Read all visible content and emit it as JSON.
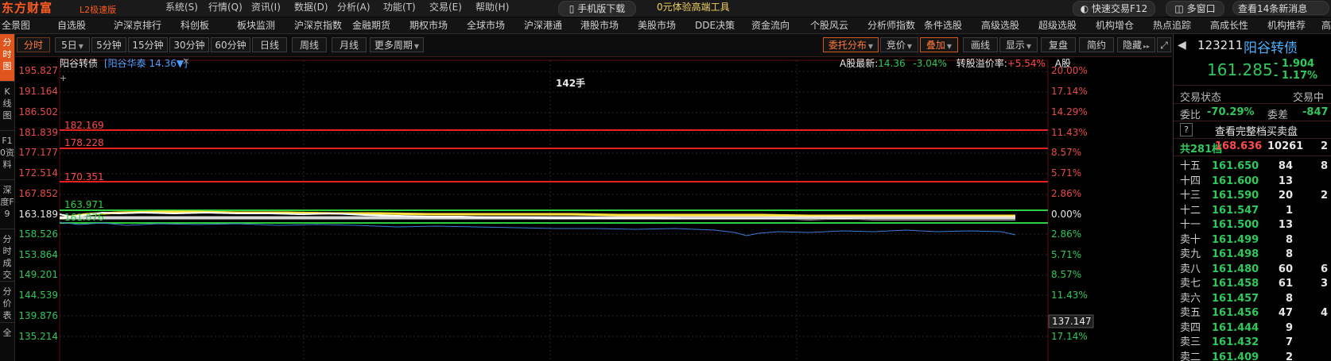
{
  "app": {
    "logo": "东方财富",
    "edition": "L2极速版"
  },
  "menu": [
    "系统(S)",
    "行情(Q)",
    "资讯(I)",
    "数据(D)",
    "分析(A)",
    "功能(T)",
    "交易(E)",
    "帮助(H)"
  ],
  "top_right": {
    "mobile_download": "手机版下载",
    "promo": "0元体验高端工具",
    "quick_trade": "快速交易F12",
    "multi_window": "多窗口",
    "news": "查看14条新消息"
  },
  "nav": [
    "全景图",
    "自选股",
    "沪深京排行",
    "科创板",
    "板块监测",
    "沪深京指数",
    "金融期货",
    "期权市场",
    "全球市场",
    "沪深港通",
    "港股市场",
    "美股市场",
    "DDE决策",
    "资金流向",
    "个股风云",
    "分析师指数",
    "条件选股",
    "高级选股",
    "超级选股",
    "机构增仓",
    "热点追踪",
    "高成长性",
    "机构推荐",
    "高"
  ],
  "left_rail": [
    {
      "label": "分时图",
      "active": true
    },
    {
      "label": "K线图",
      "active": false
    },
    {
      "label": "F10资料",
      "active": false
    },
    {
      "label": "深度F9",
      "active": false
    },
    {
      "label": "分时成交",
      "active": false
    },
    {
      "label": "分价表",
      "active": false
    },
    {
      "label": "全",
      "active": false
    }
  ],
  "toolbar": {
    "left": [
      "分时",
      "5日",
      "5分钟",
      "15分钟",
      "30分钟",
      "60分钟",
      "日线",
      "周线",
      "月线",
      "更多周期"
    ],
    "right": [
      "委托分布",
      "竞价",
      "叠加",
      "画线",
      "显示",
      "复盘",
      "简约",
      "隐藏"
    ]
  },
  "chart": {
    "stock_name": "阳谷转债",
    "overlay_tag": "[阳谷华泰 14.36▼]",
    "header_info": {
      "a_share_latest_label": "A股最新:",
      "a_share_latest_value": "14.36",
      "a_share_change": "-3.04%",
      "premium_label": "转股溢价率:",
      "premium_value": "+5.54%",
      "a_share_tag": "A股"
    },
    "volume_label": "142手",
    "price_ticks": [
      "195.827",
      "191.164",
      "186.502",
      "181.839",
      "177.177",
      "172.514",
      "167.852",
      "163.189",
      "158.526",
      "153.864",
      "149.201",
      "144.539",
      "139.876",
      "135.214"
    ],
    "pct_ticks": [
      "20.00%",
      "17.14%",
      "14.29%",
      "11.43%",
      "8.57%",
      "5.71%",
      "2.86%",
      "0.00%",
      "2.86%",
      "5.71%",
      "8.57%",
      "11.43%",
      "14.29%",
      "17.14%"
    ],
    "ref_lines": [
      {
        "label": "182.169",
        "color": "#e82020"
      },
      {
        "label": "178.228",
        "color": "#e82020"
      },
      {
        "label": "170.351",
        "color": "#e82020"
      },
      {
        "label": "163.971",
        "color": "#2fd040"
      },
      {
        "label": "161.076",
        "color": "#2fd040"
      }
    ],
    "cursor_value": "137.147"
  },
  "right_panel": {
    "code": "123211",
    "name": "阳谷转债",
    "price": "161.285",
    "change": "- 1.904",
    "change_pct": "- 1.17%",
    "status_label": "交易状态",
    "status_label2": "交易中",
    "ratio_label": "委比",
    "ratio_value": "-70.29%",
    "diff_label": "委差",
    "diff_value": "-847",
    "help_icon": "?",
    "full_book": "查看完整档买卖盘",
    "total_label": "共281档",
    "total_price": "168.636",
    "total_vol": "10261",
    "total_extra": "2",
    "book": [
      {
        "label": "十五",
        "price": "161.650",
        "vol": "84",
        "extra": "8"
      },
      {
        "label": "十四",
        "price": "161.600",
        "vol": "13",
        "extra": ""
      },
      {
        "label": "十三",
        "price": "161.590",
        "vol": "20",
        "extra": "2"
      },
      {
        "label": "十二",
        "price": "161.547",
        "vol": "1",
        "extra": ""
      },
      {
        "label": "十一",
        "price": "161.500",
        "vol": "13",
        "extra": ""
      },
      {
        "label": "卖十",
        "price": "161.499",
        "vol": "8",
        "extra": ""
      },
      {
        "label": "卖九",
        "price": "161.498",
        "vol": "8",
        "extra": ""
      },
      {
        "label": "卖八",
        "price": "161.480",
        "vol": "60",
        "extra": "6"
      },
      {
        "label": "卖七",
        "price": "161.458",
        "vol": "61",
        "extra": "3"
      },
      {
        "label": "卖六",
        "price": "161.457",
        "vol": "8",
        "extra": ""
      },
      {
        "label": "卖五",
        "price": "161.456",
        "vol": "47",
        "extra": "4"
      },
      {
        "label": "卖四",
        "price": "161.444",
        "vol": "9",
        "extra": ""
      },
      {
        "label": "卖三",
        "price": "161.432",
        "vol": "7",
        "extra": ""
      },
      {
        "label": "卖二",
        "price": "161.409",
        "vol": "2",
        "extra": ""
      }
    ]
  },
  "colors": {
    "up": "#ff4a4a",
    "down": "#2fc85a",
    "accent": "#e0541d",
    "price_line": "#ffffff",
    "avg_line": "#ffe03c",
    "overlay_line": "#3b7bd6"
  }
}
